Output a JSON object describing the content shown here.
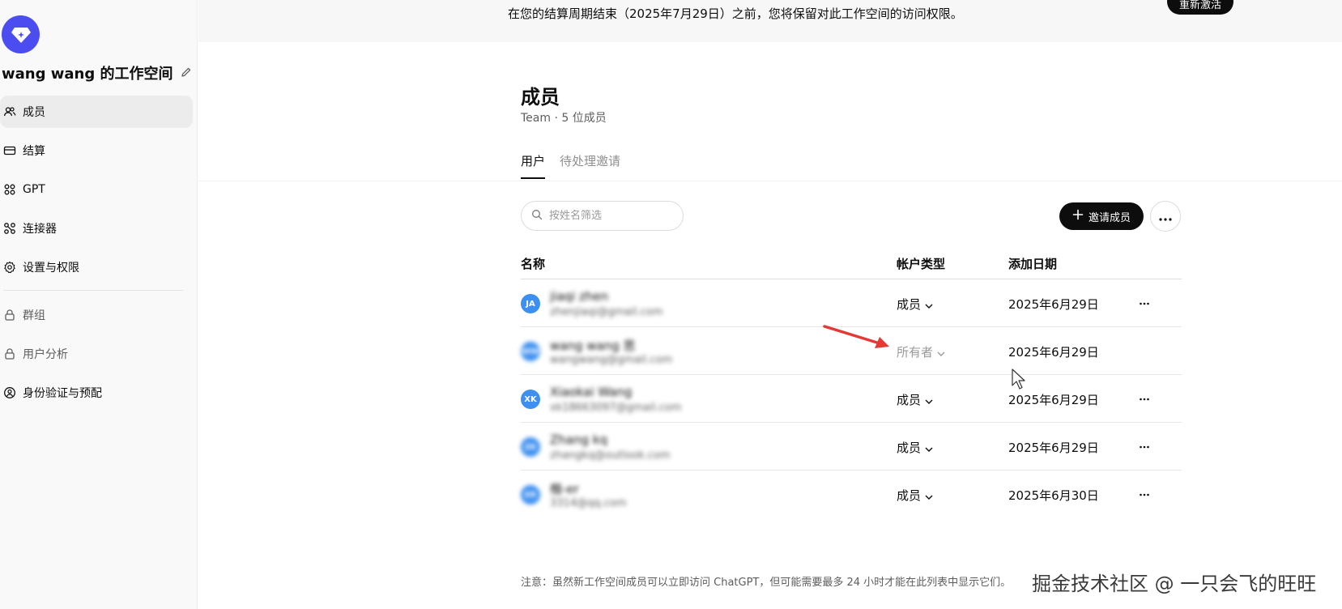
{
  "sidebar": {
    "workspace_title": "wang wang 的工作空间",
    "items": [
      {
        "label": "成员",
        "icon": "users-icon"
      },
      {
        "label": "结算",
        "icon": "card-icon"
      },
      {
        "label": "GPT",
        "icon": "grid-icon"
      },
      {
        "label": "连接器",
        "icon": "connector-icon"
      },
      {
        "label": "设置与权限",
        "icon": "gear-icon"
      }
    ],
    "locked_items": [
      {
        "label": "群组",
        "icon": "lock-icon"
      },
      {
        "label": "用户分析",
        "icon": "lock-icon"
      },
      {
        "label": "身份验证与预配",
        "icon": "shield-user-icon"
      }
    ]
  },
  "banner": {
    "text": "在您的结算周期结束（2025年7月29日）之前，您将保留对此工作空间的访问权限。",
    "button_label": "重新激活"
  },
  "main": {
    "title": "成员",
    "subtitle": "Team · 5 位成员",
    "tabs": [
      {
        "label": "用户",
        "active": true
      },
      {
        "label": "待处理邀请",
        "active": false
      }
    ],
    "search_placeholder": "按姓名筛选",
    "invite_label": "邀请成员",
    "columns": {
      "name": "名称",
      "account_type": "帐户类型",
      "date_added": "添加日期"
    },
    "rows": [
      {
        "initials": "JA",
        "name": "jiaqi zhen",
        "email": "zhenjiaqi@gmail.com",
        "role": "成员",
        "date": "2025年6月29日",
        "editable": true
      },
      {
        "initials": "WW",
        "name": "wang wang 思",
        "email": "wangwang@gmail.com",
        "role": "所有者",
        "date": "2025年6月29日",
        "editable": false
      },
      {
        "initials": "XK",
        "name": "Xiaokai Wang",
        "email": "xk18663097@gmail.com",
        "role": "成员",
        "date": "2025年6月29日",
        "editable": true
      },
      {
        "initials": "ZK",
        "name": "Zhang kq",
        "email": "zhangkq@outlook.com",
        "role": "成员",
        "date": "2025年6月29日",
        "editable": true
      },
      {
        "initials": "ER",
        "name": "楷-er",
        "email": "3314@qq.com",
        "role": "成员",
        "date": "2025年6月30日",
        "editable": true
      }
    ],
    "footnote": "注意：虽然新工作空间成员可以立即访问 ChatGPT，但可能需要最多 24 小时才能在此列表中显示它们。"
  },
  "watermark": "掘金技术社区 @ 一只会飞的旺旺",
  "colors": {
    "accent": "#4c4df0",
    "avatar": "#3d8ff0",
    "arrow": "#e53935"
  }
}
